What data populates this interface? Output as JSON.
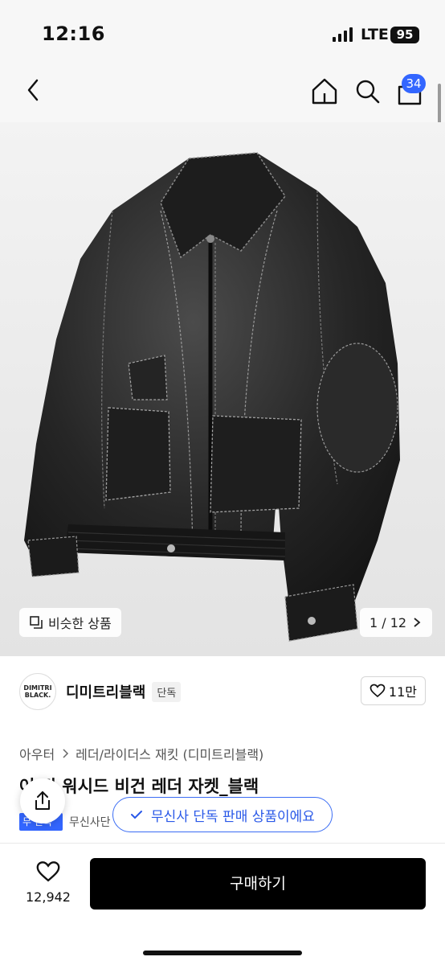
{
  "status": {
    "time": "12:16",
    "network": "LTE",
    "battery": "95"
  },
  "nav": {
    "cart_count": "34"
  },
  "gallery": {
    "similar_label": "비슷한 상품",
    "counter": "1 / 12"
  },
  "brand": {
    "logo_line1": "DIMITRI",
    "logo_line2": "BLACK.",
    "name": "디미트리블랙",
    "tag": "단독",
    "likes": "11만"
  },
  "breadcrumb": {
    "level1": "아우터",
    "level2": "레더/라이더스 재킷 (디미트리블랙)"
  },
  "product": {
    "title": "어 팅 워시드 비건 레더 자켓_블랙",
    "badge": "무 단독",
    "seller_label": "무신사단"
  },
  "toast": {
    "message": "무신사 단독 판매 상품이에요"
  },
  "footer": {
    "like_count": "12,942",
    "buy_label": "구매하기"
  },
  "colors": {
    "accent": "#3366ff",
    "buy_button": "#000000"
  }
}
